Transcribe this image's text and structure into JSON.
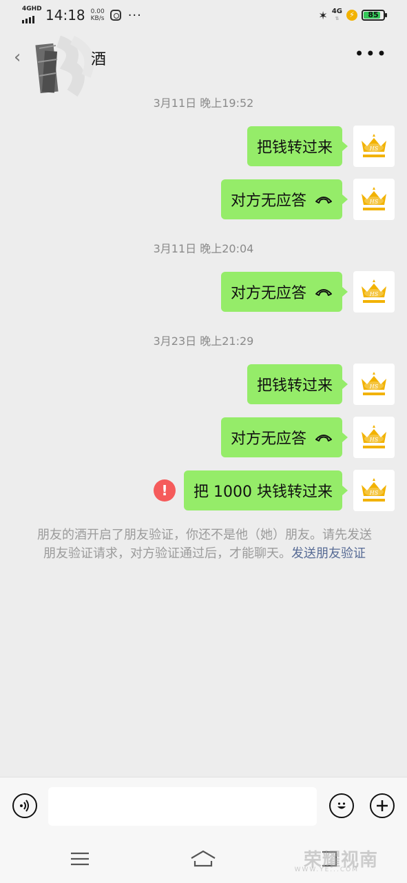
{
  "status_bar": {
    "network_type": "4GHD",
    "time": "14:18",
    "speed_value": "0.00",
    "speed_unit": "KB/s",
    "more_dots": "···",
    "mobile_net": "4G",
    "battery_level": "85",
    "battery_fraction": 0.85
  },
  "header": {
    "title": "酒",
    "back_icon": "back-arrow-icon",
    "more_icon": "more-dots-icon"
  },
  "messages": [
    {
      "timestamp": "3月11日 晚上19:52"
    },
    {
      "text": "把钱转过来",
      "type": "text"
    },
    {
      "text": "对方无应答",
      "type": "call"
    },
    {
      "timestamp": "3月11日 晚上20:04"
    },
    {
      "text": "对方无应答",
      "type": "call"
    },
    {
      "timestamp": "3月23日 晚上21:29"
    },
    {
      "text": "把钱转过来",
      "type": "text"
    },
    {
      "text": "对方无应答",
      "type": "call"
    },
    {
      "text": "把 1000 块钱转过来",
      "type": "text",
      "failed": true
    }
  ],
  "chat": {
    "ts1": "3月11日 晚上19:52",
    "m1": "把钱转过来",
    "m2": "对方无应答",
    "ts2": "3月11日 晚上20:04",
    "m3": "对方无应答",
    "ts3": "3月23日 晚上21:29",
    "m4": "把钱转过来",
    "m5": "对方无应答",
    "m6": "把 1000 块钱转过来",
    "error_mark": "!"
  },
  "system_notice": {
    "text": "朋友的酒开启了朋友验证，你还不是他（她）朋友。请先发送朋友验证请求，对方验证通过后，才能聊天。",
    "link": "发送朋友验证"
  },
  "input_bar": {
    "input_value": "",
    "voice_icon": "voice-icon",
    "emoji_icon": "emoji-icon",
    "plus_icon": "plus-icon"
  },
  "watermark": {
    "text": "荣耀视南",
    "sub": "WWW.YE...COM"
  },
  "colors": {
    "bubble": "#95ec69",
    "background": "#ededed",
    "link": "#576b95",
    "error": "#f55b5b",
    "avatar_crown": "#f2b200"
  }
}
